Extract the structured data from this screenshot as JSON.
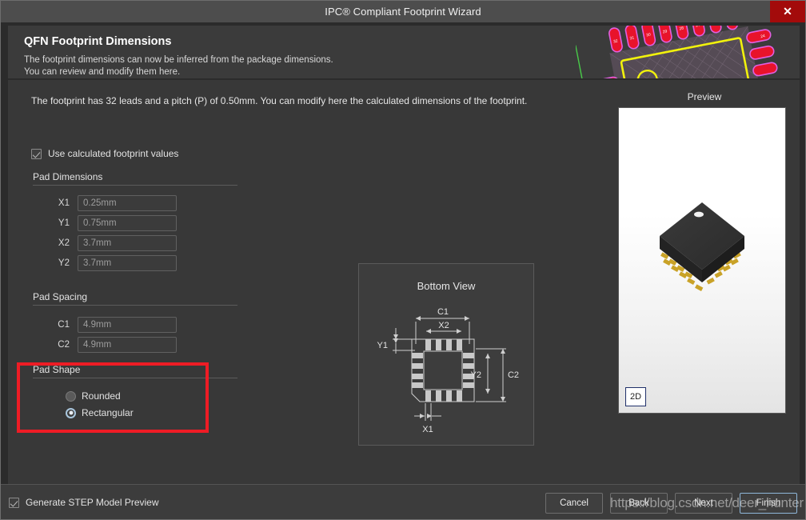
{
  "window": {
    "title": "IPC® Compliant Footprint Wizard",
    "close_label": "✕"
  },
  "header": {
    "title": "QFN Footprint Dimensions",
    "line1": "The footprint dimensions can now be inferred from the package dimensions.",
    "line2": "You can review and modify them here."
  },
  "main": {
    "intro": "The footprint has 32 leads and a pitch (P) of 0.50mm. You can modify here the calculated dimensions of the footprint.",
    "use_calculated": {
      "label": "Use calculated footprint values",
      "checked": true
    },
    "pad_dimensions": {
      "title": "Pad Dimensions",
      "fields": [
        {
          "label": "X1",
          "value": "0.25mm"
        },
        {
          "label": "Y1",
          "value": "0.75mm"
        },
        {
          "label": "X2",
          "value": "3.7mm"
        },
        {
          "label": "Y2",
          "value": "3.7mm"
        }
      ]
    },
    "pad_spacing": {
      "title": "Pad Spacing",
      "fields": [
        {
          "label": "C1",
          "value": "4.9mm"
        },
        {
          "label": "C2",
          "value": "4.9mm"
        }
      ]
    },
    "pad_shape": {
      "title": "Pad Shape",
      "options": [
        {
          "label": "Rounded",
          "selected": false
        },
        {
          "label": "Rectangular",
          "selected": true
        }
      ]
    }
  },
  "diagram": {
    "title": "Bottom View",
    "labels": {
      "c1": "C1",
      "c2": "C2",
      "x1": "X1",
      "x2": "X2",
      "y1": "Y1",
      "y2": "Y2"
    }
  },
  "preview": {
    "label": "Preview",
    "view_mode_button": "2D"
  },
  "footer": {
    "generate_step": {
      "label": "Generate STEP Model Preview",
      "checked": true
    },
    "buttons": {
      "cancel": "Cancel",
      "back": "Back",
      "next": "Next",
      "finish": "Finish"
    }
  },
  "watermark": "https://blog.csdn.net/deer_hunter",
  "colors": {
    "accent_red": "#ee1c25",
    "close_red": "#a30b0b",
    "panel_bg": "#383838",
    "header_bg": "#3b3b3b",
    "focus_blue": "#8fb8da"
  }
}
